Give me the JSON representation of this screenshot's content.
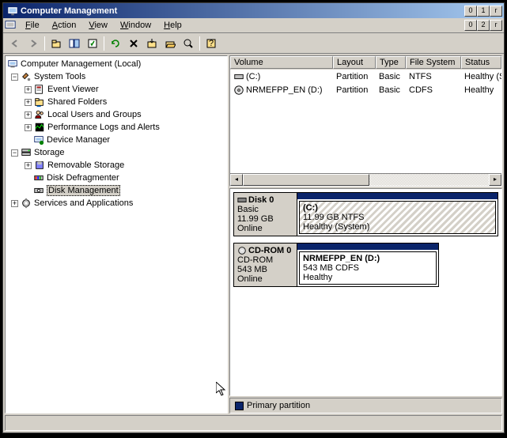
{
  "window": {
    "title": "Computer Management"
  },
  "menus": {
    "file": "File",
    "action": "Action",
    "view": "View",
    "window": "Window",
    "help": "Help"
  },
  "tree": {
    "root": "Computer Management (Local)",
    "system_tools": "System Tools",
    "event_viewer": "Event Viewer",
    "shared_folders": "Shared Folders",
    "local_users": "Local Users and Groups",
    "perf_logs": "Performance Logs and Alerts",
    "device_mgr": "Device Manager",
    "storage": "Storage",
    "removable": "Removable Storage",
    "defrag": "Disk Defragmenter",
    "diskmgmt": "Disk Management",
    "services": "Services and Applications"
  },
  "vol_headers": {
    "volume": "Volume",
    "layout": "Layout",
    "type": "Type",
    "fs": "File System",
    "status": "Status"
  },
  "volumes": [
    {
      "name": "(C:)",
      "layout": "Partition",
      "type": "Basic",
      "fs": "NTFS",
      "status": "Healthy (System"
    },
    {
      "name": "NRMEFPP_EN (D:)",
      "layout": "Partition",
      "type": "Basic",
      "fs": "CDFS",
      "status": "Healthy"
    }
  ],
  "disks": [
    {
      "name": "Disk 0",
      "kind": "Basic",
      "size": "11.99 GB",
      "state": "Online",
      "part_name": "(C:)",
      "part_desc": "11.99 GB NTFS",
      "part_status": "Healthy (System)"
    },
    {
      "name": "CD-ROM 0",
      "kind": "CD-ROM",
      "size": "543 MB",
      "state": "Online",
      "part_name": "NRMEFPP_EN (D:)",
      "part_desc": "543 MB CDFS",
      "part_status": "Healthy"
    }
  ],
  "legend": {
    "primary": "Primary partition"
  }
}
